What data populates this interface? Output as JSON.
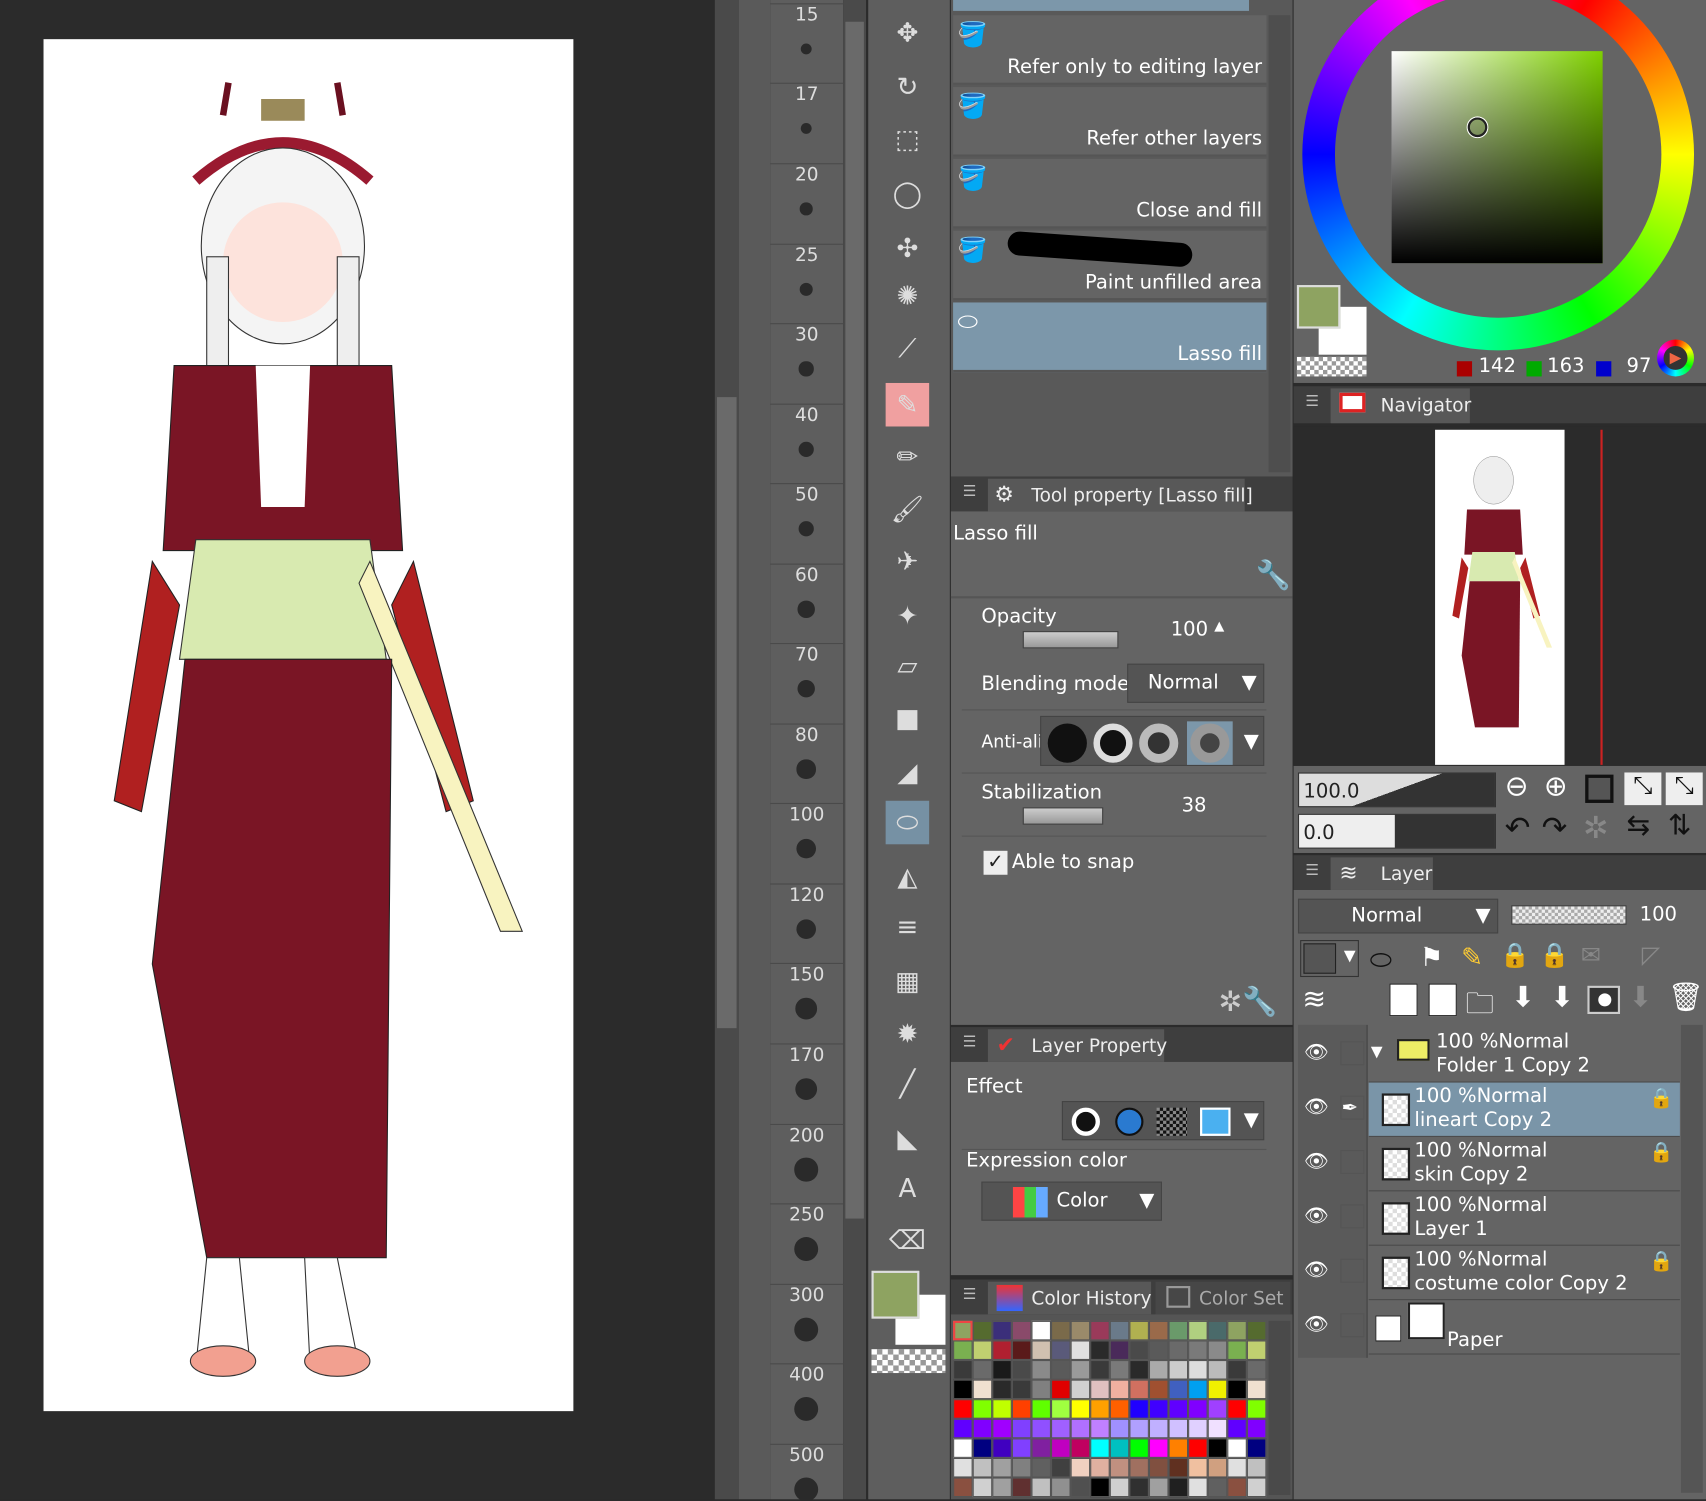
{
  "ruler": {
    "labels": [
      "15",
      "17",
      "20",
      "25",
      "30",
      "40",
      "50",
      "60",
      "70",
      "80",
      "100",
      "120",
      "150",
      "170",
      "200",
      "250",
      "300",
      "400",
      "500"
    ]
  },
  "subtools": [
    {
      "label": "Refer only to editing layer",
      "selected": false
    },
    {
      "label": "Refer other layers",
      "selected": false
    },
    {
      "label": "Close and fill",
      "selected": false
    },
    {
      "label": "Paint unfilled area",
      "selected": false
    },
    {
      "label": "Lasso fill",
      "selected": true
    }
  ],
  "tool_property": {
    "title": "Tool property [Lasso fill]",
    "tool_name": "Lasso fill",
    "opacity_label": "Opacity",
    "opacity": "100",
    "blend_label": "Blending mode",
    "blend": "Normal",
    "antialias_label": "Anti-alia",
    "stabilization_label": "Stabilization",
    "stabilization": "38",
    "snap_label": "Able to snap",
    "snap_checked": true
  },
  "layer_property": {
    "title": "Layer Property",
    "effect_label": "Effect",
    "expr_label": "Expression color",
    "expr_value": "Color"
  },
  "color_history": {
    "tab1": "Color History",
    "tab2": "Color Set",
    "rows": [
      [
        "#8ea361",
        "#556b2f",
        "#3b2f7a",
        "#8a4a6a",
        "#ffffff",
        "#7a6a4a",
        "#9a8a6a",
        "#9a3a5a",
        "#6a7a8a",
        "#b0b050",
        "#9a6a4a",
        "#6a9a6a",
        "#b0d080",
        "#4a6a6a"
      ],
      [
        "#7ab050",
        "#c0d070",
        "#b02030",
        "#5a1a1a",
        "#d0c0b0",
        "#5a5a7a",
        "#e0e0e0",
        "#2a2a2a",
        "#4a2a5a",
        "#4a4a4a",
        "#5a5a5a",
        "#6a6a6a",
        "#7a7a7a",
        "#8a8a8a"
      ],
      [
        "#3a3a3a",
        "#6a6a6a",
        "#1a1a1a",
        "#4a4a4a",
        "#8a8a8a",
        "#5a5a5a",
        "#9a9a9a",
        "#3a3a3a",
        "#7a7a7a",
        "#2a2a2a",
        "#aaaaaa",
        "#cccccc",
        "#dddddd",
        "#bbbbbb"
      ],
      [
        "#000000",
        "#f0e0d0",
        "#2a2a2a",
        "#3a3a3a",
        "#808080",
        "#e00000",
        "#d0d0d0",
        "#e0c0c0",
        "#f0b0a0",
        "#d07060",
        "#a05030",
        "#4060c0",
        "#00a0f0",
        "#f0f000"
      ],
      [
        "#ff0000",
        "#80ff00",
        "#c0ff00",
        "#ff4000",
        "#60ff00",
        "#a0ff40",
        "#ffff00",
        "#ffa000",
        "#ff6000",
        "#2000ff",
        "#4000ff",
        "#6000ff",
        "#8000ff",
        "#a040ff"
      ],
      [
        "#6000ff",
        "#8000ff",
        "#a000ff",
        "#8040ff",
        "#9050ff",
        "#a060ff",
        "#b070ff",
        "#c080ff",
        "#a090ff",
        "#b0a0ff",
        "#c0b0ff",
        "#d0c0ff",
        "#e0d0ff",
        "#f0e0ff"
      ],
      [
        "#ffffff",
        "#000080",
        "#4000c0",
        "#8040ff",
        "#8020a0",
        "#c000c0",
        "#c00060",
        "#00ffff",
        "#00c0c0",
        "#00ff00",
        "#ff00ff",
        "#ff8000",
        "#ff0000",
        "#000000"
      ],
      [
        "#e0e0e0",
        "#c0c0c0",
        "#a0a0a0",
        "#808080",
        "#606060",
        "#404040",
        "#f0d0c0",
        "#e0b0a0",
        "#c09080",
        "#a07060",
        "#805040",
        "#603020",
        "#f0c0a0",
        "#d0a080"
      ],
      [
        "#8a5040",
        "#d0d0d0",
        "#a0a0a0",
        "#603030",
        "#c0c0c0",
        "#909090",
        "#505050",
        "#000000",
        "#d0d0d0",
        "#303030",
        "#a0a0a0",
        "#202020",
        "#e0e0e0",
        "#606060"
      ]
    ]
  },
  "color": {
    "main": "#8ea361",
    "sub": "#ffffff",
    "r": "142",
    "g": "163",
    "b": "97"
  },
  "navigator": {
    "title": "Navigator",
    "zoom": "100.0",
    "rotation": "0.0"
  },
  "layer_panel": {
    "title": "Layer",
    "blend": "Normal",
    "opacity": "100",
    "layers": [
      {
        "l1": "100 %Normal",
        "l2": "Folder 1 Copy 2",
        "type": "folder",
        "locked": false,
        "selected": false
      },
      {
        "l1": "100 %Normal",
        "l2": "lineart Copy 2",
        "type": "raster",
        "locked": true,
        "selected": true
      },
      {
        "l1": "100 %Normal",
        "l2": "skin Copy 2",
        "type": "raster",
        "locked": true,
        "selected": false
      },
      {
        "l1": "100 %Normal",
        "l2": "Layer 1",
        "type": "raster",
        "locked": false,
        "selected": false
      },
      {
        "l1": "100 %Normal",
        "l2": "costume color Copy 2",
        "type": "raster",
        "locked": true,
        "selected": false
      },
      {
        "l1": "",
        "l2": "Paper",
        "type": "paper",
        "locked": false,
        "selected": false
      }
    ]
  }
}
